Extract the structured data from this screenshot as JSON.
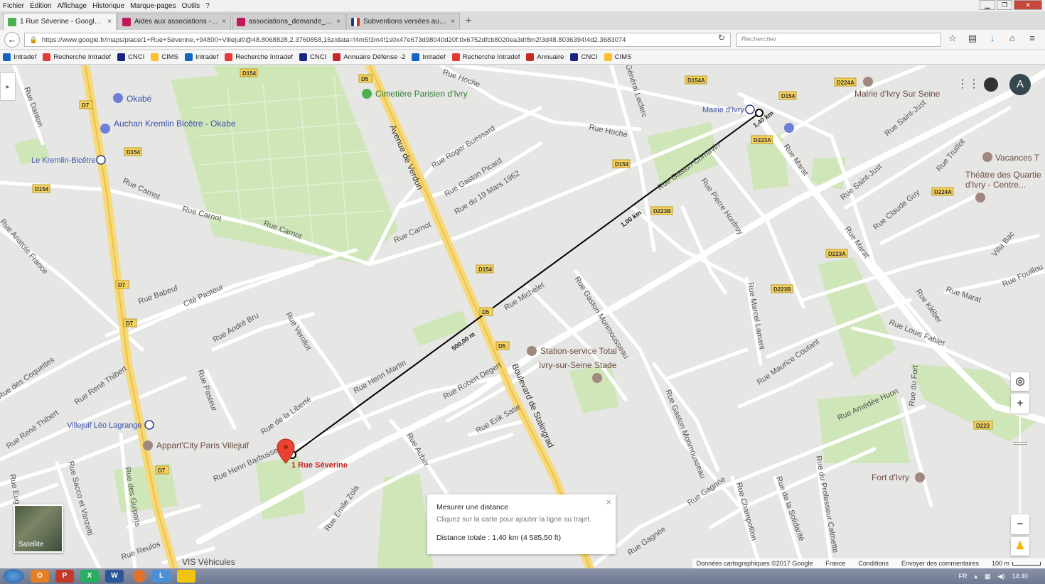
{
  "menubar": {
    "items": [
      "Fichier",
      "Édition",
      "Affichage",
      "Historique",
      "Marque-pages",
      "Outils",
      "?"
    ]
  },
  "tabs": [
    {
      "label": "1 Rue Séverine - Google M...",
      "color": "#4caf50",
      "active": true
    },
    {
      "label": "Aides aux associations - Vil...",
      "color": "#c2185b",
      "active": false
    },
    {
      "label": "associations_demande_sub...",
      "color": "#c2185b",
      "active": false
    },
    {
      "label": "Subventions versées aux as...",
      "color": "#1a3a8a",
      "active": false
    }
  ],
  "new_tab_label": "+",
  "url": "https://www.google.fr/maps/place/1+Rue+Séverine,+94800+Villejuif/@48.8068828,2.3760858,16z/data=!4m5!3m4!1s0x47e673d98040d20f:0x6752dfcb8020ea3d!8m2!3d48.8036394!4d2.3683074",
  "search_placeholder": "Rechercher",
  "bookmarks": [
    {
      "label": "Intradef",
      "color": "#1565c0"
    },
    {
      "label": "Recherche Intradef",
      "color": "#e53935"
    },
    {
      "label": "CNCI",
      "color": "#1a237e"
    },
    {
      "label": "CIMS",
      "color": "#fbc02d"
    },
    {
      "label": "Intradef",
      "color": "#1565c0"
    },
    {
      "label": "Recherche Intradef",
      "color": "#e53935"
    },
    {
      "label": "CNCI",
      "color": "#1a237e"
    },
    {
      "label": "Annuaire Défense -2",
      "color": "#c62828"
    },
    {
      "label": "Intradef",
      "color": "#1565c0"
    },
    {
      "label": "Recherche Intradef",
      "color": "#e53935"
    },
    {
      "label": "Annuaire",
      "color": "#c62828"
    },
    {
      "label": "CNCI",
      "color": "#1a237e"
    },
    {
      "label": "CIMS",
      "color": "#fbc02d"
    }
  ],
  "map": {
    "streets": [
      "Rue Danton",
      "Rue Carnot",
      "Rue Carnot",
      "Rue Carnot",
      "Rue Carnot",
      "Avenue de Verdun",
      "Rue Roger Buessard",
      "Rue Gaston Picard",
      "Rue du 19 Mars 1962",
      "Rue Hoche",
      "Rue Hoche",
      "Général Leclerc",
      "Rue Gaston Cornavin",
      "Rue Pierre Honfroy",
      "Rue Marat",
      "Rue Marat",
      "Rue Marat",
      "Rue Saint-Just",
      "Rue Saint-Just",
      "Rue Claude Guy",
      "Rue Truillot",
      "Rue Fouillou",
      "Villa Bac",
      "Rue Kléber",
      "Rue Louis Fablet",
      "Rue Michelet",
      "Rue Gaston Monmousseau",
      "Rue Gaston Monmousseau",
      "Rue Marcel Lamant",
      "Rue Maurice Coutant",
      "Rue Amédée Huon",
      "Rue du Fort",
      "Rue Anatole France",
      "Rue Babeuf",
      "Cité Pasteur",
      "Rue André Bru",
      "Rue Verollot",
      "Rue Henri Martin",
      "Rue Robert Degert",
      "Boulevard de Stalingrad",
      "Rue Erik Satie",
      "Rue Auber",
      "Rue des Coquettes",
      "Rue René Thibert",
      "Rue René Thibert",
      "Rue Pasteur",
      "Rue de la Liberté",
      "Rue Henri Barbusse",
      "Rue Emile Zola",
      "Rue Sacco et Vanzetti",
      "Rue des Guipons",
      "Rue Eugène Pe",
      "Rue Reulos",
      "Rue Gagnée",
      "Rue Gagnée",
      "Rue Champollion",
      "Rue de la Solidarité",
      "Rue du Professeur Calmette"
    ],
    "road_badges": [
      "D154",
      "D5",
      "D7",
      "D154",
      "D154",
      "D7",
      "D7",
      "D154",
      "D5",
      "D5",
      "D154",
      "D223B",
      "D223B",
      "D223A",
      "D223A",
      "D224A",
      "D224A",
      "D154A",
      "D154",
      "D223",
      "D7"
    ],
    "pois": [
      {
        "label": "Okabé"
      },
      {
        "label": "Auchan Kremlin Bicêtre - Okabe"
      },
      {
        "label": "Le Kremlin-Bicêtre"
      },
      {
        "label": "Cimetière Parisien d'Ivry"
      },
      {
        "label": "Mairie d'Ivry"
      },
      {
        "label": "Mairie d'Ivry Sur Seine"
      },
      {
        "label": "Vacances T"
      },
      {
        "label": "Théâtre des Quartie d'Ivry - Centre..."
      },
      {
        "label": "Station-service Total"
      },
      {
        "label": "Ivry-sur-Seine Stade"
      },
      {
        "label": "Villejuif Léo Lagrange"
      },
      {
        "label": "Appart'City Paris Villejuif"
      },
      {
        "label": "Fort d'Ivry"
      },
      {
        "label": "VIS Véhicules"
      }
    ],
    "marker_label": "1 Rue Séverine",
    "distance_labels": [
      "500,00 m",
      "1,00 km",
      "1,40 km"
    ],
    "satellite_label": "Satellite",
    "user_initial": "A",
    "zoom_in": "+",
    "zoom_out": "−"
  },
  "measure_panel": {
    "title": "Mesurer une distance",
    "hint": "Cliquez sur la carte pour ajouter la ligne au trajet.",
    "total": "Distance totale : 1,40 km (4 585,50 ft)",
    "close": "×"
  },
  "footer": {
    "copyright": "Données cartographiques ©2017 Google",
    "country": "France",
    "conditions": "Conditions",
    "feedback": "Envoyer des commentaires",
    "scale": "100 m"
  },
  "taskbar": {
    "apps": [
      {
        "label": "O",
        "color": "#e67e22"
      },
      {
        "label": "P",
        "color": "#c0392b"
      },
      {
        "label": "X",
        "color": "#27ae60"
      },
      {
        "label": "W",
        "color": "#2b579a"
      },
      {
        "label": "",
        "color": "#e2722b"
      },
      {
        "label": "L",
        "color": "#4a90d9"
      },
      {
        "label": "",
        "color": "#f1c40f"
      }
    ],
    "lang": "FR",
    "time": "14:40"
  }
}
